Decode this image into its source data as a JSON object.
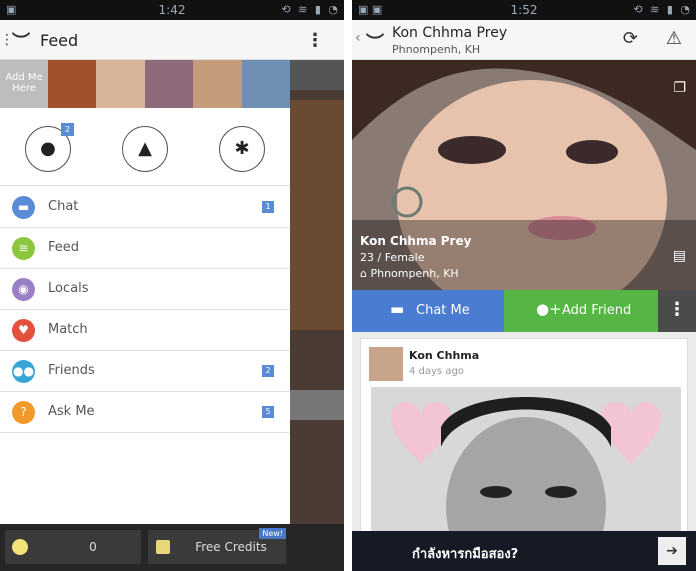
{
  "left_screen": {
    "status": {
      "time": "1:42"
    },
    "appbar": {
      "title": "Feed"
    },
    "photostrip": {
      "add_me": "Add Me Here",
      "thumb_colors": [
        "#a0522d",
        "#d7b49a",
        "#8e6b7a",
        "#c59c7a",
        "#6f90b5"
      ]
    },
    "quick_actions": {
      "profile_badge": "2"
    },
    "menu": [
      {
        "label": "Chat",
        "icon": "chat-icon",
        "color": "#5a8bd6",
        "badge": "1"
      },
      {
        "label": "Feed",
        "icon": "feed-icon",
        "color": "#8cc63f",
        "badge": ""
      },
      {
        "label": "Locals",
        "icon": "location-pin-icon",
        "color": "#9b7fc4",
        "badge": ""
      },
      {
        "label": "Match",
        "icon": "heart-icon",
        "color": "#e3503e",
        "badge": ""
      },
      {
        "label": "Friends",
        "icon": "people-icon",
        "color": "#3aa6d8",
        "badge": "2"
      },
      {
        "label": "Ask Me",
        "icon": "question-icon",
        "color": "#f19a2a",
        "badge": "5"
      }
    ],
    "bottombar": {
      "coins": "0",
      "free_credits": "Free Credits",
      "new_badge": "New!"
    }
  },
  "right_screen": {
    "status": {
      "time": "1:52"
    },
    "header": {
      "name": "Kon Chhma Prey",
      "location": "Phnompenh, KH"
    },
    "hero": {
      "name": "Kon Chhma Prey",
      "age_gender": "23 / Female",
      "location": "Phnompenh, KH"
    },
    "actions": {
      "chat": "Chat Me",
      "add_friend": "Add Friend"
    },
    "post": {
      "author": "Kon Chhma",
      "time": "4 days ago"
    },
    "ad": {
      "text": "กำลังหารกมือสอง?"
    }
  }
}
